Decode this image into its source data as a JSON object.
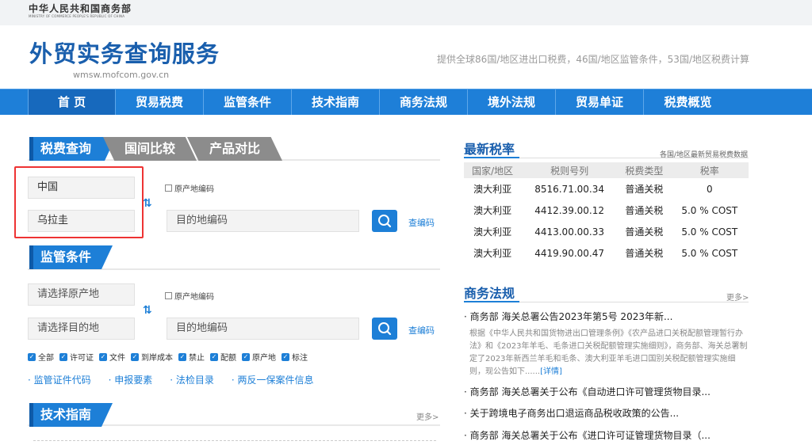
{
  "header": {
    "ministry_cn": "中华人民共和国商务部",
    "ministry_en": "MINISTRY OF COMMERCE PEOPLE'S REPUBLIC OF CHINA",
    "site_title": "外贸实务查询服务",
    "site_url": "wmsw.mofcom.gov.cn",
    "site_desc": "提供全球86国/地区进出口税费，46国/地区监管条件，53国/地区税费计算"
  },
  "nav": [
    "首 页",
    "贸易税费",
    "监管条件",
    "技术指南",
    "商务法规",
    "境外法规",
    "贸易单证",
    "税费概览"
  ],
  "tax_query": {
    "tabs": [
      "税费查询",
      "国间比较",
      "产品对比"
    ],
    "origin_value": "中国",
    "destination_value": "乌拉圭",
    "origin_code_checkbox": "原产地编码",
    "dest_code_placeholder": "目的地编码",
    "code_lookup": "查编码"
  },
  "regulatory": {
    "title": "监管条件",
    "origin_placeholder": "请选择原产地",
    "destination_placeholder": "请选择目的地",
    "origin_code_checkbox": "原产地编码",
    "dest_code_placeholder": "目的地编码",
    "code_lookup": "查编码",
    "checkboxes": [
      "全部",
      "许可证",
      "文件",
      "到岸成本",
      "禁止",
      "配额",
      "原产地",
      "标注"
    ],
    "links": [
      "· 监管证件代码",
      "· 申报要素",
      "· 法检目录",
      "· 两反一保案件信息"
    ]
  },
  "tech_guide": {
    "title": "技术指南",
    "more": "更多>"
  },
  "latest_rates": {
    "title": "最新税率",
    "subtitle": "各国/地区最新贸易税费数据",
    "columns": [
      "国家/地区",
      "税则号列",
      "税费类型",
      "税率"
    ],
    "rows": [
      [
        "澳大利亚",
        "8516.71.00.34",
        "普通关税",
        "0"
      ],
      [
        "澳大利亚",
        "4412.39.00.12",
        "普通关税",
        "5.0 % COST"
      ],
      [
        "澳大利亚",
        "4413.00.00.33",
        "普通关税",
        "5.0 % COST"
      ],
      [
        "澳大利亚",
        "4419.90.00.47",
        "普通关税",
        "5.0 % COST"
      ]
    ]
  },
  "commerce_law": {
    "title": "商务法规",
    "more": "更多>",
    "items": [
      "· 商务部 海关总署公告2023年第5号 2023年新...",
      "· 商务部 海关总署关于公布《自动进口许可管理货物目录...",
      "· 关于跨境电子商务出口退运商品税收政策的公告...",
      "· 商务部 海关总署关于公布《进口许可证管理货物目录（..."
    ],
    "summary": "根据《中华人民共和国货物进出口管理条例》《农产品进口关税配额管理暂行办法》和《2023年羊毛、毛条进口关税配额管理实施细则》，商务部、海关总署制定了2023年新西兰羊毛和毛条、澳大利亚羊毛进口国别关税配额管理实施细则，现公告如下......",
    "detail": "[详情]"
  }
}
